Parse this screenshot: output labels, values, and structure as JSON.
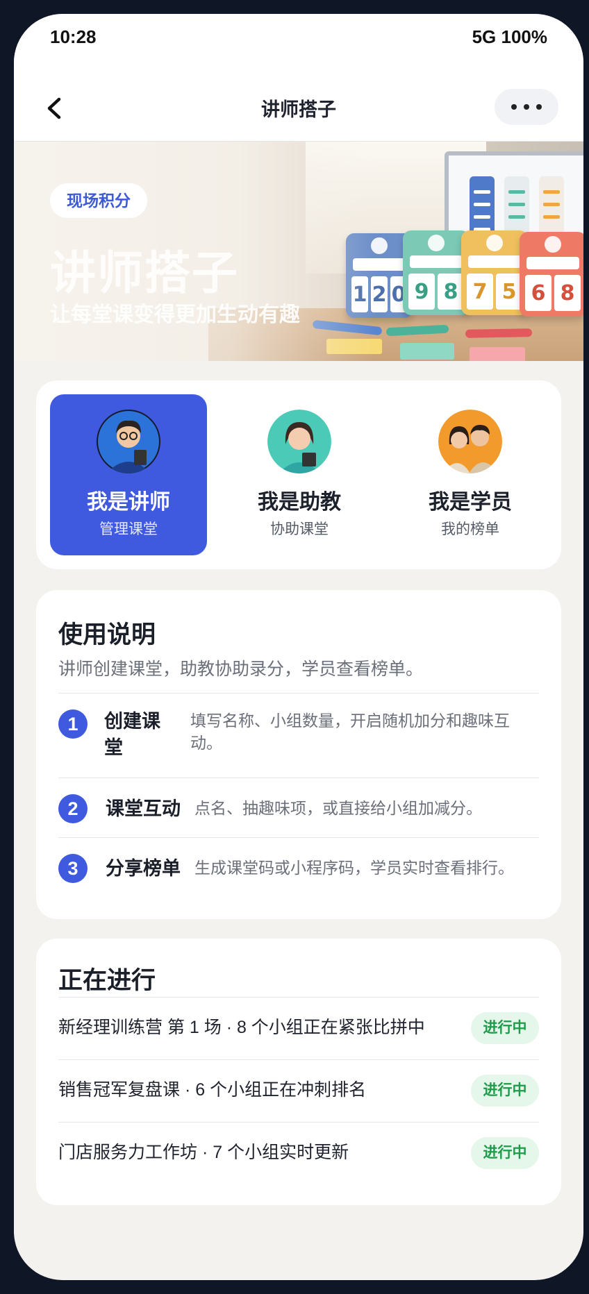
{
  "status_bar": {
    "time": "10:28",
    "right": "5G 100%"
  },
  "nav": {
    "title": "讲师搭子",
    "back_icon": "chevron-left-icon",
    "more_icon": "more-dots-icon"
  },
  "hero": {
    "tag": "现场积分",
    "title": "讲师搭子",
    "subtitle": "让每堂课变得更加生动有趣",
    "score_cards": [
      {
        "digits": [
          "1",
          "2",
          "0"
        ],
        "color": "#6d8fc9",
        "digit_color": "#4d6fae"
      },
      {
        "digits": [
          "9",
          "8"
        ],
        "color": "#7cc9b5",
        "digit_color": "#3a9f86"
      },
      {
        "digits": [
          "7",
          "5"
        ],
        "color": "#f0c05e",
        "digit_color": "#d8962c"
      },
      {
        "digits": [
          "6",
          "8"
        ],
        "color": "#ee7a66",
        "digit_color": "#d4503c"
      }
    ]
  },
  "roles": [
    {
      "title": "我是讲师",
      "subtitle": "管理课堂",
      "active": true
    },
    {
      "title": "我是助教",
      "subtitle": "协助课堂",
      "active": false
    },
    {
      "title": "我是学员",
      "subtitle": "我的榜单",
      "active": false
    }
  ],
  "guide": {
    "title": "使用说明",
    "desc": "讲师创建课堂，助教协助录分，学员查看榜单。",
    "steps": [
      {
        "num": "1",
        "title_line1": "创建课",
        "title_line2": "堂",
        "desc_line1": "填写名称、小组数量，开启随机加分和趣味互",
        "desc_line2": "动。"
      },
      {
        "num": "2",
        "title": "课堂互动",
        "desc": "点名、抽趣味项，或直接给小组加减分。"
      },
      {
        "num": "3",
        "title": "分享榜单",
        "desc": "生成课堂码或小程序码，学员实时查看排行。"
      }
    ]
  },
  "running": {
    "title": "正在进行",
    "items": [
      {
        "text": "新经理训练营 第 1 场 · 8 个小组正在紧张比拼中",
        "badge": "进行中"
      },
      {
        "text": "销售冠军复盘课 · 6 个小组正在冲刺排名",
        "badge": "进行中"
      },
      {
        "text": "门店服务力工作坊 · 7 个小组实时更新",
        "badge": "进行中"
      }
    ]
  },
  "colors": {
    "accent": "#3f5ade",
    "badge_bg": "#e5f6ea",
    "badge_text": "#1e9b4a"
  }
}
